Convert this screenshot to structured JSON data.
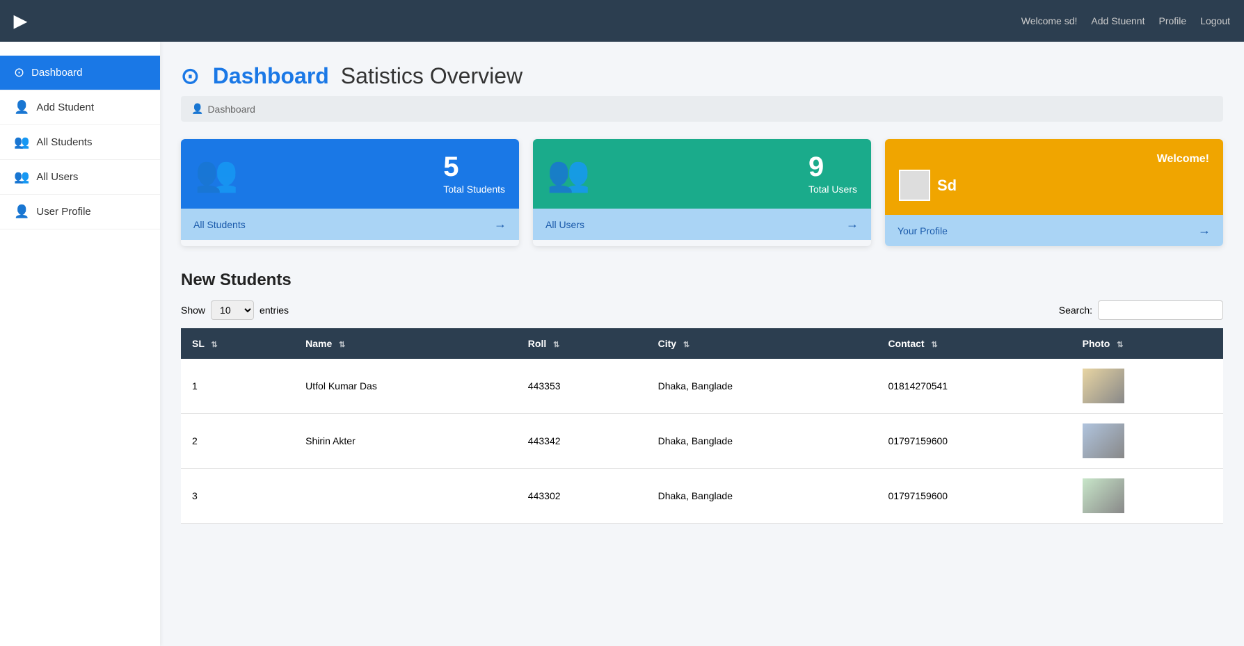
{
  "header": {
    "logo": "▶",
    "welcome": "Welcome sd!",
    "add_student": "Add Stuennt",
    "profile": "Profile",
    "logout": "Logout"
  },
  "sidebar": {
    "items": [
      {
        "id": "dashboard",
        "label": "Dashboard",
        "icon": "⊙",
        "active": true
      },
      {
        "id": "add-student",
        "label": "Add Student",
        "icon": "👤+",
        "active": false
      },
      {
        "id": "all-students",
        "label": "All Students",
        "icon": "👥",
        "active": false
      },
      {
        "id": "all-users",
        "label": "All Users",
        "icon": "👥",
        "active": false
      },
      {
        "id": "user-profile",
        "label": "User Profile",
        "icon": "👤",
        "active": false
      }
    ]
  },
  "page": {
    "title_blue": "Dashboard",
    "title_rest": "Satistics Overview",
    "breadcrumb_icon": "👤",
    "breadcrumb_text": "Dashboard"
  },
  "cards": {
    "students": {
      "number": "5",
      "label": "Total Students",
      "link": "All Students"
    },
    "users": {
      "number": "9",
      "label": "Total Users",
      "link": "All Users"
    },
    "profile": {
      "welcome": "Welcome!",
      "username": "Sd",
      "link": "Your Profile"
    }
  },
  "table": {
    "section_title": "New Students",
    "show_label": "Show",
    "show_value": "10",
    "entries_label": "entries",
    "search_label": "Search:",
    "columns": [
      {
        "id": "sl",
        "label": "SL"
      },
      {
        "id": "name",
        "label": "Name"
      },
      {
        "id": "roll",
        "label": "Roll"
      },
      {
        "id": "city",
        "label": "City"
      },
      {
        "id": "contact",
        "label": "Contact"
      },
      {
        "id": "photo",
        "label": "Photo"
      }
    ],
    "rows": [
      {
        "sl": "1",
        "name": "Utfol Kumar Das",
        "roll": "443353",
        "city": "Dhaka, Banglade",
        "contact": "01814270541"
      },
      {
        "sl": "2",
        "name": "Shirin Akter",
        "roll": "443342",
        "city": "Dhaka, Banglade",
        "contact": "01797159600"
      },
      {
        "sl": "3",
        "name": "",
        "roll": "443302",
        "city": "Dhaka, Banglade",
        "contact": "01797159600"
      }
    ]
  }
}
